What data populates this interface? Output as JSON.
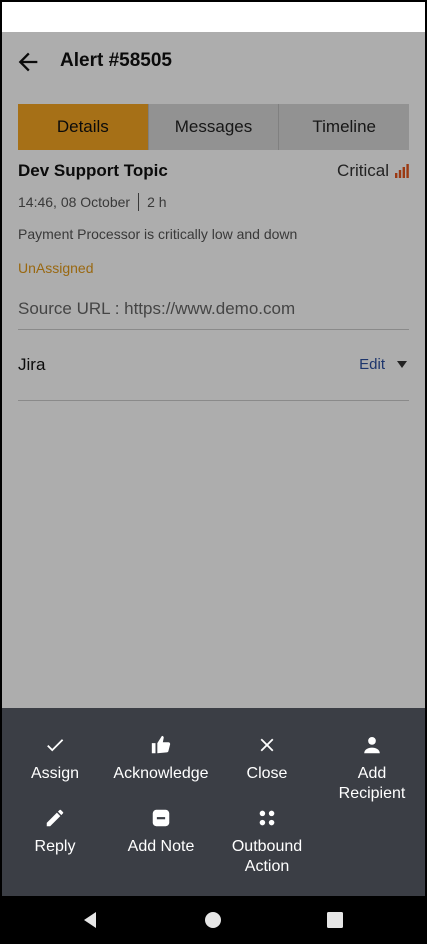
{
  "header": {
    "title": "Alert #58505"
  },
  "tabs": [
    {
      "label": "Details",
      "active": true
    },
    {
      "label": "Messages",
      "active": false
    },
    {
      "label": "Timeline",
      "active": false
    }
  ],
  "details": {
    "topic": "Dev Support Topic",
    "severity": "Critical",
    "time": "14:46, 08 October",
    "age": "2 h",
    "description": "Payment Processor is critically low and down",
    "assign_status": "UnAssigned",
    "source_url": "Source URL : https://www.demo.com",
    "jira_label": "Jira",
    "jira_edit": "Edit"
  },
  "actions": [
    {
      "label": "Assign",
      "icon": "check-icon"
    },
    {
      "label": "Acknowledge",
      "icon": "thumbs-up-icon"
    },
    {
      "label": "Close",
      "icon": "close-icon"
    },
    {
      "label": "Add Recipient",
      "icon": "person-icon"
    },
    {
      "label": "Reply",
      "icon": "pencil-icon"
    },
    {
      "label": "Add Note",
      "icon": "note-icon"
    },
    {
      "label": "Outbound Action",
      "icon": "grid-icon"
    }
  ],
  "colors": {
    "accent": "#f5a623",
    "sheet": "#3b3e45",
    "link": "#2b4fa0",
    "unassigned": "#e29a1a"
  }
}
